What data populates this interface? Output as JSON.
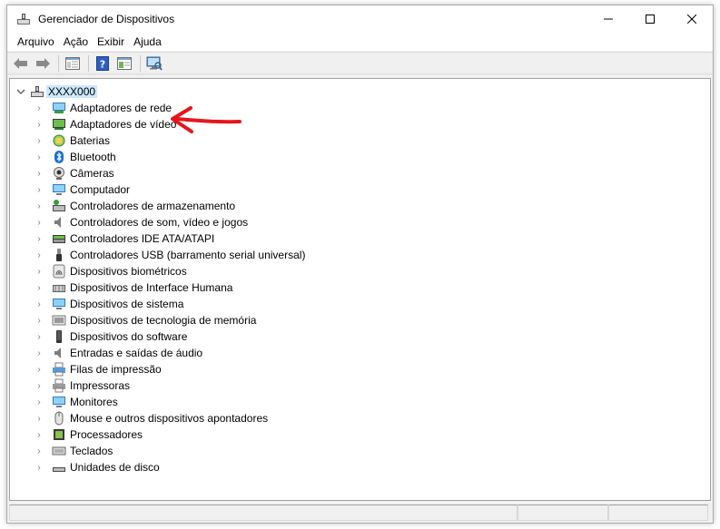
{
  "window": {
    "title": "Gerenciador de Dispositivos",
    "controls": {
      "minimize": "—",
      "maximize": "☐",
      "close": "✕"
    }
  },
  "menu": {
    "items": [
      "Arquivo",
      "Ação",
      "Exibir",
      "Ajuda"
    ]
  },
  "toolbar": {
    "buttons": [
      "back-icon",
      "forward-icon",
      "show-hide-console-tree-icon",
      "help-icon",
      "properties-icon",
      "scan-hardware-icon"
    ]
  },
  "tree": {
    "root": "XXXX000",
    "categories": [
      {
        "label": "Adaptadores de rede",
        "icon": "network-adapter-icon"
      },
      {
        "label": "Adaptadores de vídeo",
        "icon": "display-adapter-icon"
      },
      {
        "label": "Baterias",
        "icon": "battery-icon"
      },
      {
        "label": "Bluetooth",
        "icon": "bluetooth-icon"
      },
      {
        "label": "Câmeras",
        "icon": "camera-icon"
      },
      {
        "label": "Computador",
        "icon": "computer-icon"
      },
      {
        "label": "Controladores de armazenamento",
        "icon": "storage-controller-icon"
      },
      {
        "label": "Controladores de som, vídeo e jogos",
        "icon": "sound-icon"
      },
      {
        "label": "Controladores IDE ATA/ATAPI",
        "icon": "ide-controller-icon"
      },
      {
        "label": "Controladores USB (barramento serial universal)",
        "icon": "usb-icon"
      },
      {
        "label": "Dispositivos biométricos",
        "icon": "fingerprint-icon"
      },
      {
        "label": "Dispositivos de Interface Humana",
        "icon": "hid-icon"
      },
      {
        "label": "Dispositivos de sistema",
        "icon": "system-device-icon"
      },
      {
        "label": "Dispositivos de tecnologia de memória",
        "icon": "memory-icon"
      },
      {
        "label": "Dispositivos do software",
        "icon": "software-device-icon"
      },
      {
        "label": "Entradas e saídas de áudio",
        "icon": "audio-io-icon"
      },
      {
        "label": "Filas de impressão",
        "icon": "print-queue-icon"
      },
      {
        "label": "Impressoras",
        "icon": "printer-icon"
      },
      {
        "label": "Monitores",
        "icon": "monitor-icon"
      },
      {
        "label": "Mouse e outros dispositivos apontadores",
        "icon": "mouse-icon"
      },
      {
        "label": "Processadores",
        "icon": "processor-icon"
      },
      {
        "label": "Teclados",
        "icon": "keyboard-icon"
      },
      {
        "label": "Unidades de disco",
        "icon": "disk-drive-icon"
      }
    ]
  },
  "colors": {
    "root_highlight": "#cce8ff",
    "annotation_arrow": "#e8141c"
  }
}
